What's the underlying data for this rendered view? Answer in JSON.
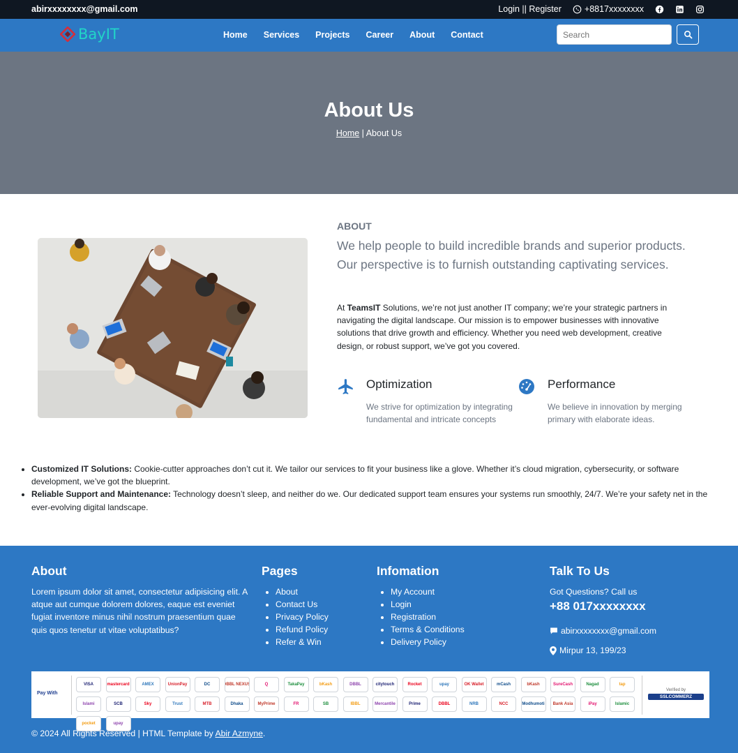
{
  "topbar": {
    "email": "abirxxxxxxxx@gmail.com",
    "auth": "Login || Register",
    "phone": "+8817xxxxxxxx",
    "social": [
      "facebook-icon",
      "linkedin-icon",
      "instagram-icon"
    ]
  },
  "navbar": {
    "logo_text": "BayIT",
    "links": [
      "Home",
      "Services",
      "Projects",
      "Career",
      "About",
      "Contact"
    ],
    "search_placeholder": "Search"
  },
  "hero": {
    "title": "About Us",
    "breadcrumb_home": "Home",
    "breadcrumb_sep": " | ",
    "breadcrumb_current": "About Us"
  },
  "about": {
    "label": "ABOUT",
    "lead": "We help people to build incredible brands and superior products. Our perspective is to furnish outstanding captivating services.",
    "para_prefix": "At ",
    "para_brand": "TeamsIT",
    "para_rest": " Solutions, we’re not just another IT company; we’re your strategic partners in navigating the digital landscape. Our mission is to empower businesses with innovative solutions that drive growth and efficiency. Whether you need web development, creative design, or robust support, we’ve got you covered.",
    "features": [
      {
        "title": "Optimization",
        "text": "We strive for optimization by integrating fundamental and intricate concepts"
      },
      {
        "title": "Performance",
        "text": "We believe in innovation by merging primary with elaborate ideas."
      }
    ]
  },
  "bullets": [
    {
      "title": "Customized IT Solutions:",
      "text": " Cookie-cutter approaches don’t cut it. We tailor our services to fit your business like a glove. Whether it’s cloud migration, cybersecurity, or software development, we’ve got the blueprint."
    },
    {
      "title": "Reliable Support and Maintenance:",
      "text": " Technology doesn’t sleep, and neither do we. Our dedicated support team ensures your systems run smoothly, 24/7. We’re your safety net in the ever-evolving digital landscape."
    }
  ],
  "footer": {
    "about_title": "About",
    "about_text": "Lorem ipsum dolor sit amet, consectetur adipisicing elit. A atque aut cumque dolorem dolores, eaque est eveniet fugiat inventore minus nihil nostrum praesentium quae quis quos tenetur ut vitae voluptatibus?",
    "pages_title": "Pages",
    "pages": [
      "About",
      "Contact Us",
      "Privacy Policy",
      "Refund Policy",
      "Refer & Win"
    ],
    "info_title": "Infomation",
    "info": [
      "My Account",
      "Login",
      "Registration",
      "Terms & Conditions",
      "Delivery Policy"
    ],
    "talk_title": "Talk To Us",
    "talk_sub": "Got Questions? Call us",
    "talk_phone": "+88 017xxxxxxxx",
    "talk_email": "abirxxxxxxxx@gmail.com",
    "talk_address": "Mirpur 13, 199/23",
    "pay_label": "Pay With",
    "payment_logos": [
      "VISA",
      "mastercard",
      "AMEX",
      "UnionPay",
      "DC",
      "DBBL NEXUS",
      "Q",
      "TakaPay",
      "bKash",
      "DBBL",
      "citytouch",
      "Rocket",
      "upay",
      "OK Wallet",
      "mCash",
      "bKash",
      "SureCash",
      "Nagad",
      "tap",
      "Islami",
      "SCB",
      "Sky",
      "Trust",
      "MTB",
      "Dhaka",
      "MyPrime",
      "FR",
      "SB",
      "IBBL",
      "Mercantile",
      "Prime",
      "DBBL",
      "NRB",
      "NCC",
      "Modhumoti",
      "Bank Asia",
      "iPay",
      "Islamic",
      "pocket",
      "upay"
    ],
    "verified_text": "Verified by",
    "verified_brand": "SSLCOMMERZ",
    "copyright": "© 2024 All Rights Reserved | HTML Template by ",
    "author": "Abir Azmyne",
    "copyright_end": "."
  },
  "colors": {
    "topbar": "#0f1722",
    "brand_blue": "#2d78c4",
    "hero_gray": "#6c7582",
    "logo_teal": "#21d5c8",
    "logo_red": "#d32f3c"
  }
}
